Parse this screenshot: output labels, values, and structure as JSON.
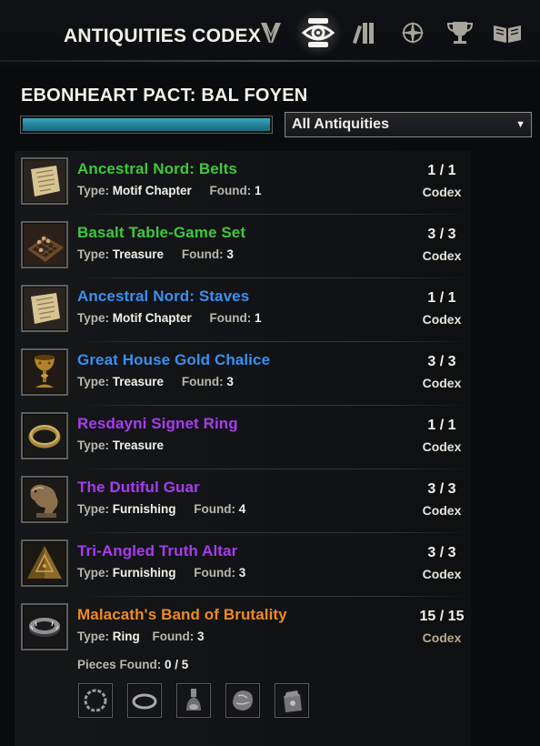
{
  "header": {
    "title": "ANTIQUITIES CODEX",
    "tabs": [
      {
        "icon": "tab-v-crest-icon",
        "active": false
      },
      {
        "icon": "tab-codex-eye-icon",
        "active": true
      },
      {
        "icon": "tab-books-icon",
        "active": false
      },
      {
        "icon": "tab-compass-star-icon",
        "active": false
      },
      {
        "icon": "tab-trophy-icon",
        "active": false
      },
      {
        "icon": "tab-open-book-icon",
        "active": false
      }
    ]
  },
  "zone": {
    "title": "EBONHEART PACT: BAL FOYEN",
    "progress": 1.0
  },
  "filter": {
    "selected": "All Antiquities",
    "arrow": "▼"
  },
  "labels": {
    "type": "Type:",
    "found": "Found:",
    "codex": "Codex",
    "pieces_found": "Pieces Found:"
  },
  "colors": {
    "green": "#3ec83c",
    "blue": "#3b8ff0",
    "purple": "#a83cf0",
    "orange": "#ef8a22",
    "progress": "#217d92"
  },
  "items": [
    {
      "name": "Ancestral Nord: Belts",
      "quality": "green",
      "type": "Motif Chapter",
      "found": "1",
      "count": "1 / 1",
      "icon": "scroll-icon"
    },
    {
      "name": "Basalt Table-Game Set",
      "quality": "green",
      "type": "Treasure",
      "found": "3",
      "count": "3 / 3",
      "icon": "game-board-icon"
    },
    {
      "name": "Ancestral Nord: Staves",
      "quality": "blue",
      "type": "Motif Chapter",
      "found": "1",
      "count": "1 / 1",
      "icon": "scroll-icon"
    },
    {
      "name": "Great House Gold Chalice",
      "quality": "blue",
      "type": "Treasure",
      "found": "3",
      "count": "3 / 3",
      "icon": "chalice-icon"
    },
    {
      "name": "Resdayni Signet Ring",
      "quality": "purple",
      "type": "Treasure",
      "found": "",
      "count": "1 / 1",
      "icon": "ring-icon"
    },
    {
      "name": "The Dutiful Guar",
      "quality": "purple",
      "type": "Furnishing",
      "found": "4",
      "count": "3 / 3",
      "icon": "guar-statue-icon"
    },
    {
      "name": "Tri-Angled Truth Altar",
      "quality": "purple",
      "type": "Furnishing",
      "found": "3",
      "count": "3 / 3",
      "icon": "pyramid-altar-icon"
    },
    {
      "name": "Malacath's Band of Brutality",
      "quality": "orange",
      "type": "Ring",
      "found": "3",
      "count": "15 / 15",
      "icon": "band-ring-icon"
    }
  ],
  "pieces": {
    "found": "0 / 5",
    "icons": [
      "chain-icon",
      "ring-piece-icon",
      "vial-icon",
      "ore-chunk-icon",
      "pouch-icon"
    ]
  }
}
